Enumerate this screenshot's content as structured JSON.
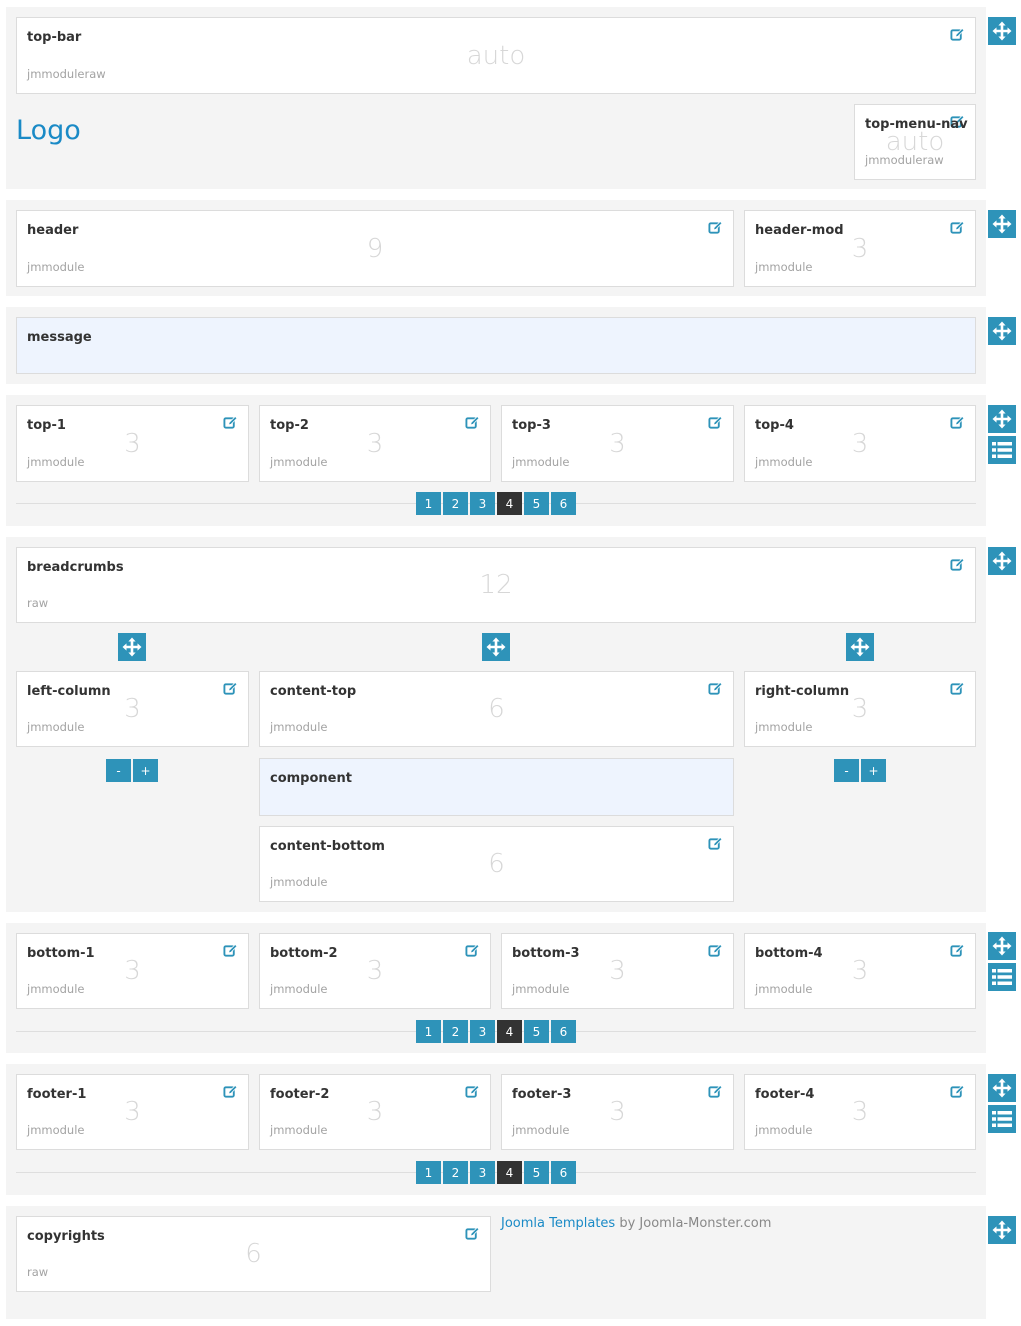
{
  "logo": "Logo",
  "sections": {
    "topbar": {
      "topbar": {
        "name": "top-bar",
        "size": "auto",
        "type": "jmmoduleraw"
      },
      "topmenu": {
        "name": "top-menu-nav",
        "size": "auto",
        "type": "jmmoduleraw"
      }
    },
    "header": {
      "header": {
        "name": "header",
        "size": "9",
        "type": "jmmodule"
      },
      "headermod": {
        "name": "header-mod",
        "size": "3",
        "type": "jmmodule"
      }
    },
    "message": {
      "name": "message"
    },
    "top": [
      {
        "name": "top-1",
        "size": "3",
        "type": "jmmodule"
      },
      {
        "name": "top-2",
        "size": "3",
        "type": "jmmodule"
      },
      {
        "name": "top-3",
        "size": "3",
        "type": "jmmodule"
      },
      {
        "name": "top-4",
        "size": "3",
        "type": "jmmodule"
      }
    ],
    "main": {
      "breadcrumbs": {
        "name": "breadcrumbs",
        "size": "12",
        "type": "raw"
      },
      "left": {
        "name": "left-column",
        "size": "3",
        "type": "jmmodule"
      },
      "contenttop": {
        "name": "content-top",
        "size": "6",
        "type": "jmmodule"
      },
      "right": {
        "name": "right-column",
        "size": "3",
        "type": "jmmodule"
      },
      "component": {
        "name": "component"
      },
      "contentbottom": {
        "name": "content-bottom",
        "size": "6",
        "type": "jmmodule"
      }
    },
    "bottom": [
      {
        "name": "bottom-1",
        "size": "3",
        "type": "jmmodule"
      },
      {
        "name": "bottom-2",
        "size": "3",
        "type": "jmmodule"
      },
      {
        "name": "bottom-3",
        "size": "3",
        "type": "jmmodule"
      },
      {
        "name": "bottom-4",
        "size": "3",
        "type": "jmmodule"
      }
    ],
    "footer": [
      {
        "name": "footer-1",
        "size": "3",
        "type": "jmmodule"
      },
      {
        "name": "footer-2",
        "size": "3",
        "type": "jmmodule"
      },
      {
        "name": "footer-3",
        "size": "3",
        "type": "jmmodule"
      },
      {
        "name": "footer-4",
        "size": "3",
        "type": "jmmodule"
      }
    ],
    "copyrights": {
      "name": "copyrights",
      "size": "6",
      "type": "raw"
    }
  },
  "pager": {
    "pages": [
      "1",
      "2",
      "3",
      "4",
      "5",
      "6"
    ],
    "active": "4"
  },
  "stepper": {
    "minus": "-",
    "plus": "+"
  },
  "credit": {
    "link": "Joomla Templates",
    "rest": " by Joomla-Monster.com"
  },
  "colors": {
    "accent": "#2e93b9",
    "active_page": "#333333",
    "logo": "#1a8ac6",
    "section_bg": "#f4f4f4",
    "highlight_box": "#eef4fe"
  },
  "icons": {
    "edit": "edit-icon",
    "move": "move-icon",
    "list": "list-icon"
  }
}
